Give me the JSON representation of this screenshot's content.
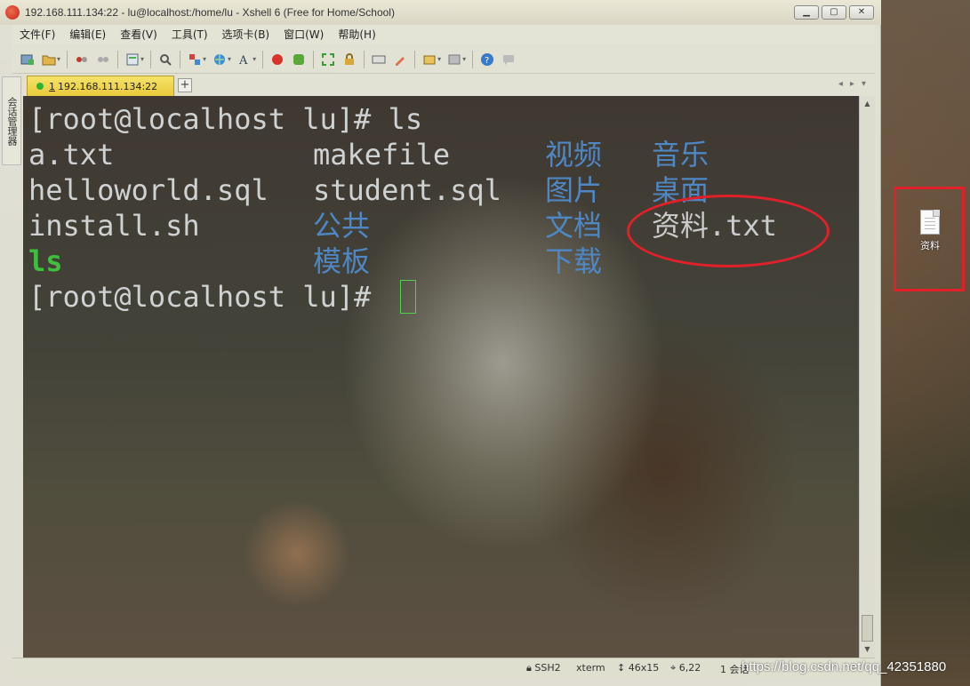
{
  "window": {
    "title": "192.168.111.134:22 - lu@localhost:/home/lu - Xshell 6 (Free for Home/School)",
    "controls": {
      "minimize": "▁",
      "maximize": "▢",
      "close": "✕"
    }
  },
  "menu": {
    "items": [
      "文件(F)",
      "编辑(E)",
      "查看(V)",
      "工具(T)",
      "选项卡(B)",
      "窗口(W)",
      "帮助(H)"
    ]
  },
  "side_strip": {
    "label": "会话管理器"
  },
  "tabs": {
    "active": {
      "index": "1",
      "label": "192.168.111.134:22"
    },
    "add": "+"
  },
  "terminal": {
    "prompt1": "[root@localhost lu]# ls",
    "rows": [
      {
        "col1": "a.txt",
        "col2": "makefile",
        "col3": "视频",
        "col4": "音乐"
      },
      {
        "col1": "helloworld.sql",
        "col2": "student.sql",
        "col3": "图片",
        "col4": "桌面"
      },
      {
        "col1": "install.sh",
        "col2": "公共",
        "col3": "文档",
        "col4": "资料.txt"
      },
      {
        "col1": "ls",
        "col2": "模板",
        "col3": "下载",
        "col4": ""
      }
    ],
    "prompt2": "[root@localhost lu]# "
  },
  "status": {
    "protocol": "SSH2",
    "terminal_type": "xterm",
    "size": "46x15",
    "position": "6,22",
    "sessions": "1 会话"
  },
  "desktop": {
    "icon_label": "资料"
  },
  "watermark": "https://blog.csdn.net/qq_42351880",
  "colors": {
    "accent_red": "#e0202a",
    "dir_blue": "#4f87c4",
    "exec_green": "#3fbf3f",
    "tab_yellow": "#e9c93b"
  }
}
